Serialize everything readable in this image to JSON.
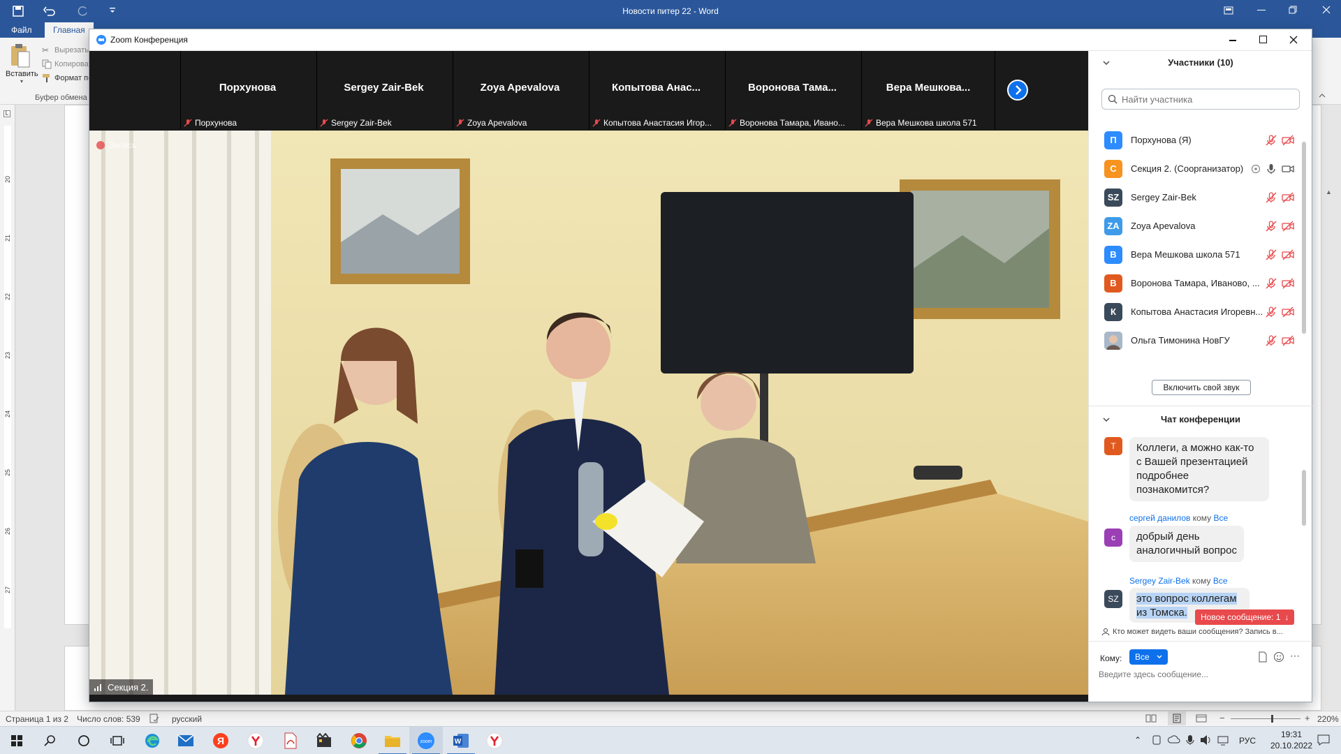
{
  "word": {
    "window_title": "Новости питер 22 - Word",
    "tabs": [
      "Файл",
      "Главная"
    ],
    "ribbon": {
      "groups": [
        {
          "paste_label": "Вставить",
          "items": [
            {
              "label": "Вырезать",
              "icon": "scissors-icon"
            },
            {
              "label": "Копировать",
              "icon": "copy-icon"
            },
            {
              "label": "Формат по образцу",
              "icon": "format-painter-icon"
            }
          ],
          "group_label": "Буфер обмена"
        }
      ]
    },
    "ruler_numbers": [
      "20",
      "21",
      "22",
      "23",
      "24",
      "25",
      "26",
      "27"
    ],
    "status": {
      "page": "Страница 1 из 2",
      "words": "Число слов: 539",
      "language": "русский",
      "zoom": "220%"
    }
  },
  "zoom": {
    "window_title": "Zoom Конференция",
    "thumbnails": [
      {
        "name": "Порхунова",
        "label": "Порхунова"
      },
      {
        "name": "Sergey Zair-Bek",
        "label": "Sergey Zair-Bek"
      },
      {
        "name": "Zoya Apevalova",
        "label": "Zoya Apevalova"
      },
      {
        "name": "Копытова Анас...",
        "label": "Копытова Анастасия Игор..."
      },
      {
        "name": "Воронова Тама...",
        "label": "Воронова Тамара, Ивано..."
      },
      {
        "name": "Вера Мешкова...",
        "label": "Вера Мешкова школа 571"
      }
    ],
    "main_video": {
      "recording_label": "Запись",
      "speaker_label": "Секция 2."
    },
    "participants": {
      "title": "Участники (10)",
      "search_placeholder": "Найти участника",
      "list": [
        {
          "initials": "П",
          "name": "Порхунова (Я)",
          "color": "#2d8cff"
        },
        {
          "initials": "С",
          "name": "Секция 2. (Соорганизатор)",
          "color": "#f7931e"
        },
        {
          "initials": "SZ",
          "name": "Sergey Zair-Bek",
          "color": "#3b4a5a"
        },
        {
          "initials": "ZA",
          "name": "Zoya Apevalova",
          "color": "#3d9be9"
        },
        {
          "initials": "В",
          "name": "Вера Мешкова школа 571",
          "color": "#2d8cff"
        },
        {
          "initials": "В",
          "name": "Воронова Тамара, Иваново, ...",
          "color": "#e05a1f"
        },
        {
          "initials": "К",
          "name": "Копытова Анастасия Игоревн...",
          "color": "#3b4a5a"
        },
        {
          "initials": "",
          "name": "Ольга Тимонина НовГУ",
          "color": "#c9b5a8"
        }
      ],
      "unmute_button": "Включить свой звук"
    },
    "chat": {
      "title": "Чат конференции",
      "messages": [
        {
          "initials": "Т",
          "color": "#e05a1f",
          "sender": "",
          "to_word": "",
          "to": "",
          "text": "Коллеги, а можно как-то с Вашей презентацией подробнее познакомится?"
        },
        {
          "initials": "с",
          "color": "#9b3fb5",
          "sender": "сергей данилов",
          "to_word": "кому",
          "to": "Все",
          "text": "добрый день аналогичный вопрос"
        },
        {
          "initials": "SZ",
          "color": "#3b4a5a",
          "sender": "Sergey Zair-Bek",
          "to_word": "кому",
          "to": "Все",
          "text": "это вопрос коллегам из Томска."
        }
      ],
      "new_message_badge": "Новое сообщение: 1",
      "visibility_note": "Кто может видеть ваши сообщения? Запись в...",
      "to_label": "Кому:",
      "to_value": "Все",
      "input_placeholder": "Введите здесь сообщение..."
    }
  },
  "taskbar": {
    "time": "19:31",
    "date": "20.10.2022",
    "lang": "РУС"
  },
  "ui_colors": {
    "word_blue": "#2b579a",
    "zoom_blue": "#0e71eb",
    "alert_red": "#e8494c"
  }
}
